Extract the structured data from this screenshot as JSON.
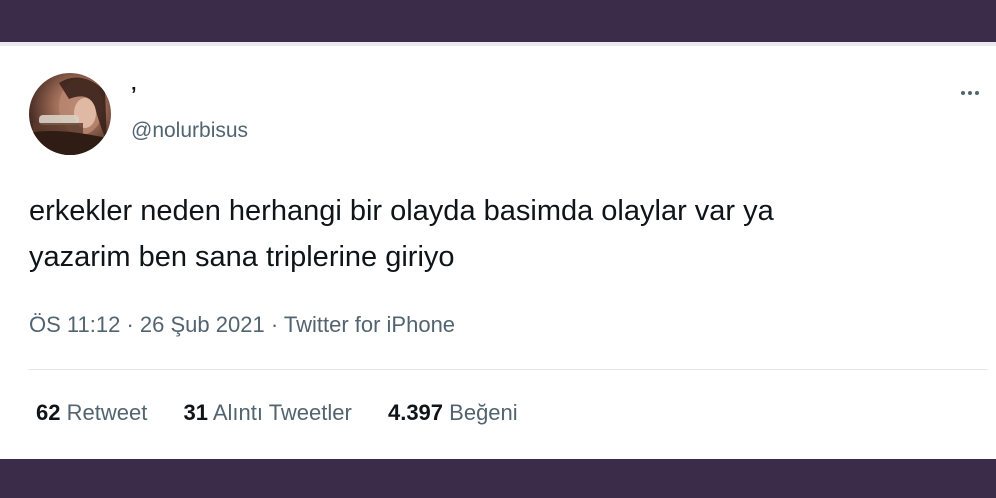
{
  "tweet": {
    "display_name": "’",
    "handle": "@nolurbisus",
    "text_line1": "erkekler neden herhangi bir olayda basimda olaylar var ya",
    "text_line2": "yazarim ben sana triplerine giriyo",
    "time": "ÖS 11:12",
    "separator": "·",
    "date": "26 Şub 2021",
    "source": "Twitter for iPhone",
    "more_icon": "more-dots-icon"
  },
  "stats": {
    "retweets_count": "62",
    "retweets_label": "Retweet",
    "quotes_count": "31",
    "quotes_label": "Alıntı Tweetler",
    "likes_count": "4.397",
    "likes_label": "Beğeni"
  },
  "colors": {
    "frame_background": "#3b2d4a",
    "card_background": "#ffffff",
    "primary_text": "#0f1419",
    "secondary_text": "#536471"
  }
}
